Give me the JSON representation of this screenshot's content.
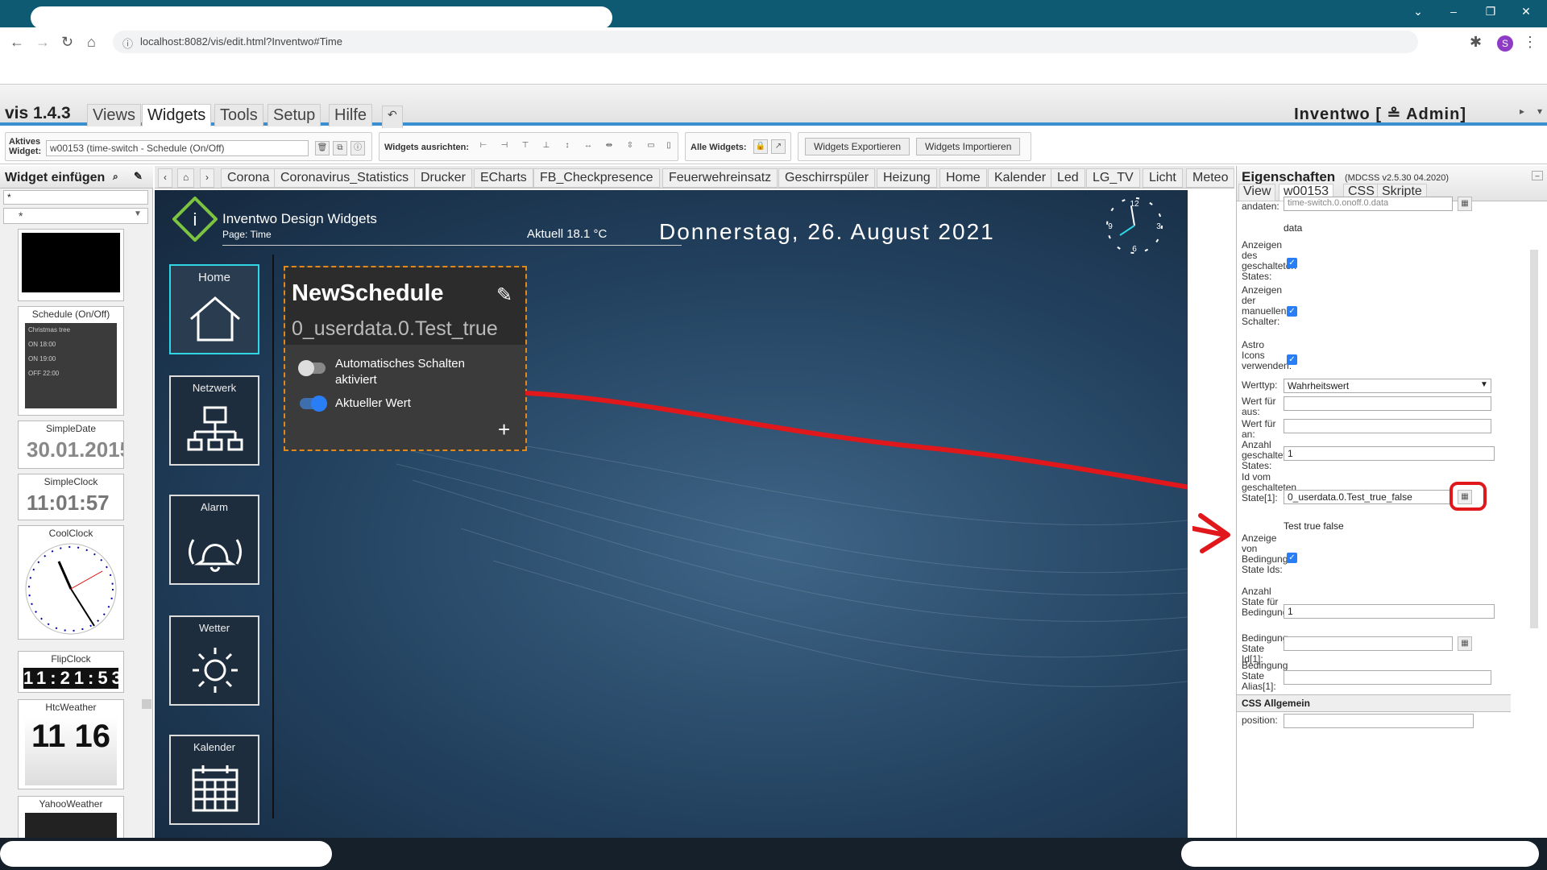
{
  "browser": {
    "url": "localhost:8082/vis/edit.html?Inventwo#Time"
  },
  "menu": {
    "version": "vis 1.4.3",
    "tabs": [
      "Views",
      "Widgets",
      "Tools",
      "Setup",
      "Hilfe"
    ],
    "user": "Inventwo [ ≗ Admin]"
  },
  "toolbar": {
    "active_label": "Aktives Widget:",
    "active_value": "w00153 (time-switch - Schedule (On/Off)",
    "align_label": "Widgets ausrichten:",
    "all_label": "Alle Widgets:",
    "export_label": "Widgets Exportieren",
    "import_label": "Widgets Importieren"
  },
  "palette": {
    "title": "Widget einfügen",
    "filter": "*",
    "items": [
      "Schedule (On/Off)",
      "SimpleDate",
      "SimpleClock",
      "CoolClock",
      "FlipClock",
      "HtcWeather",
      "YahooWeather"
    ],
    "simpledate_value": "30.01.2015",
    "simpleclock_value": "11:01:57",
    "flipclock_value": "11:21:53",
    "htc_value": "11 16"
  },
  "views": [
    "Corona",
    "Coronavirus_Statistics",
    "Drucker",
    "ECharts",
    "FB_Checkpresence",
    "Feuerwehreinsatz",
    "Geschirrspüler",
    "Heizung",
    "Home",
    "Kalender",
    "Led",
    "LG_TV",
    "Licht",
    "Meteo"
  ],
  "canvas": {
    "brand": "Inventwo Design Widgets",
    "page": "Page: Time",
    "temp": "Aktuell 18.1 °C",
    "date": "Donnerstag, 26. August 2021",
    "nav": [
      "Home",
      "Netzwerk",
      "Alarm",
      "Wetter",
      "Kalender"
    ],
    "schedule": {
      "title": "NewSchedule",
      "state": "0_userdata.0.Test_true",
      "toggle1": "Automatisches Schalten aktiviert",
      "toggle2": "Aktueller Wert",
      "add": "+"
    }
  },
  "props": {
    "title": "Eigenschaften",
    "version": "(MDCSS v2.5.30 04.2020)",
    "tabs": [
      "View",
      "w00153",
      "CSS",
      "Skripte"
    ],
    "rows": {
      "r0_label": "andaten:",
      "r0_value": "time-switch.0.onoff.0.data",
      "r0_text": "data",
      "r1_label": "Anzeigen des geschalteten States:",
      "r2_label": "Anzeigen der manuellen Schalter:",
      "r3_label": "Astro Icons verwenden:",
      "werttyp_label": "Werttyp:",
      "werttyp_value": "Wahrheitswert",
      "aus_label": "Wert für aus:",
      "an_label": "Wert für an:",
      "anzahl_label": "Anzahl geschalteter States:",
      "anzahl_value": "1",
      "id_label": "Id vom geschalteten State[1]:",
      "id_value": "0_userdata.0.Test_true_false",
      "id_text": "Test true false",
      "bed_label": "Anzeige von Bedingungs State Ids:",
      "bedanz_label": "Anzahl State für Bedingungen:",
      "bedanz_value": "1",
      "bedid_label": "Bedingung State Id[1]:",
      "bedalias_label": "Bedingung State Alias[1]:"
    },
    "css_section": "CSS Allgemein",
    "position_label": "position:"
  },
  "colors": {
    "accent": "#3a8fd0",
    "highlight": "#e0181c",
    "schedule_border": "#e08a1e"
  }
}
